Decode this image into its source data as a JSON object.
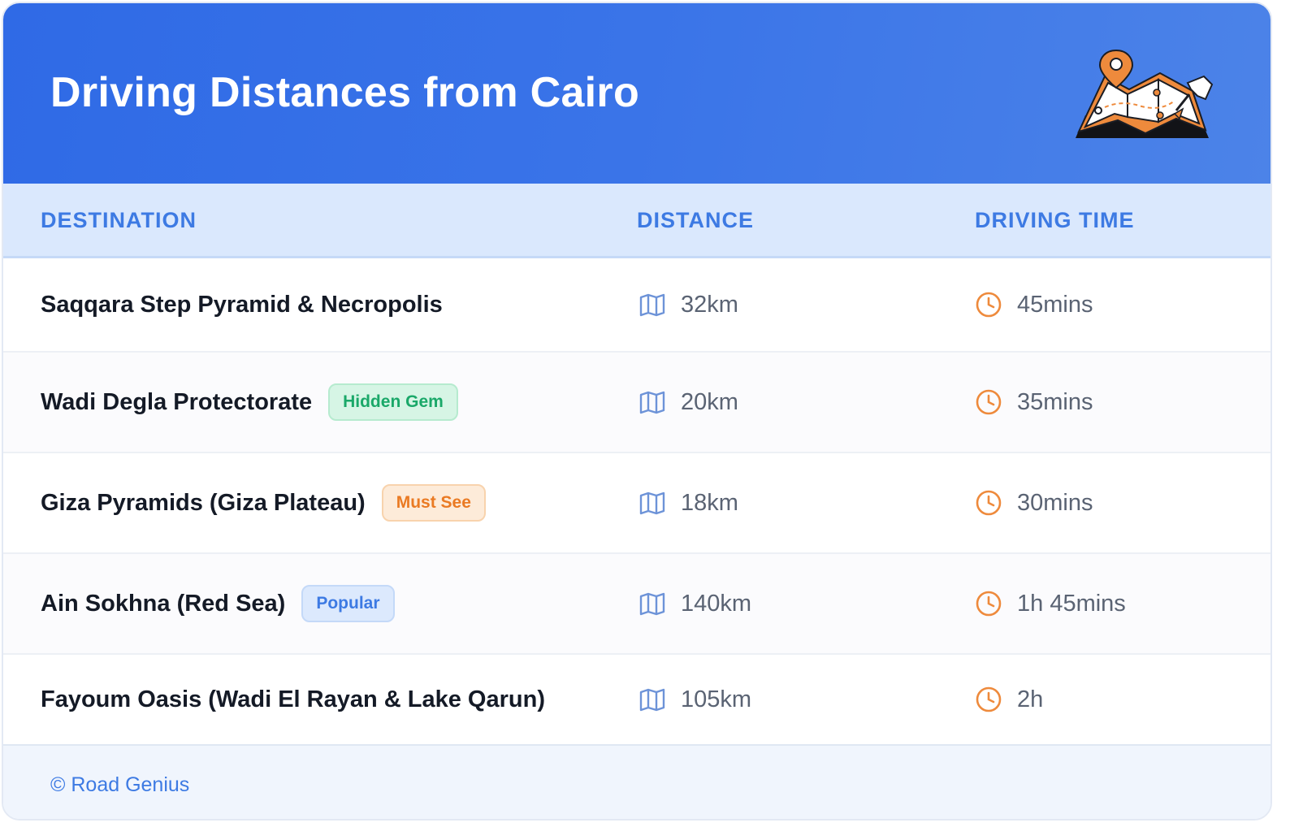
{
  "header": {
    "title": "Driving Distances from Cairo",
    "illustration_icon": "map-with-pins-illustration"
  },
  "table": {
    "columns": [
      "DESTINATION",
      "DISTANCE",
      "DRIVING TIME"
    ],
    "rows": [
      {
        "destination": "Saqqara Step Pyramid & Necropolis",
        "badge": "",
        "distance": "32km",
        "time": "45mins"
      },
      {
        "destination": "Wadi Degla Protectorate",
        "badge": "Hidden Gem",
        "badge_type": "green",
        "distance": "20km",
        "time": "35mins"
      },
      {
        "destination": "Giza Pyramids (Giza Plateau)",
        "badge": "Must See",
        "badge_type": "orange",
        "distance": "18km",
        "time": "30mins"
      },
      {
        "destination": "Ain Sokhna (Red Sea)",
        "badge": "Popular",
        "badge_type": "blue",
        "distance": "140km",
        "time": "1h 45mins"
      },
      {
        "destination": "Fayoum Oasis (Wadi El Rayan & Lake Qarun)",
        "badge": "",
        "distance": "105km",
        "time": "2h"
      }
    ],
    "distance_icon": "map-icon",
    "time_icon": "clock-icon"
  },
  "footer": {
    "copyright": "© Road Genius"
  },
  "colors": {
    "header_start": "#2f6ae6",
    "header_end": "#4c83e8",
    "accent_blue": "#3d7ae3",
    "accent_orange": "#ee8a3c",
    "badge_green_text": "#1aa869",
    "badge_orange_text": "#ea7a23",
    "badge_blue_text": "#3d7ae3"
  }
}
